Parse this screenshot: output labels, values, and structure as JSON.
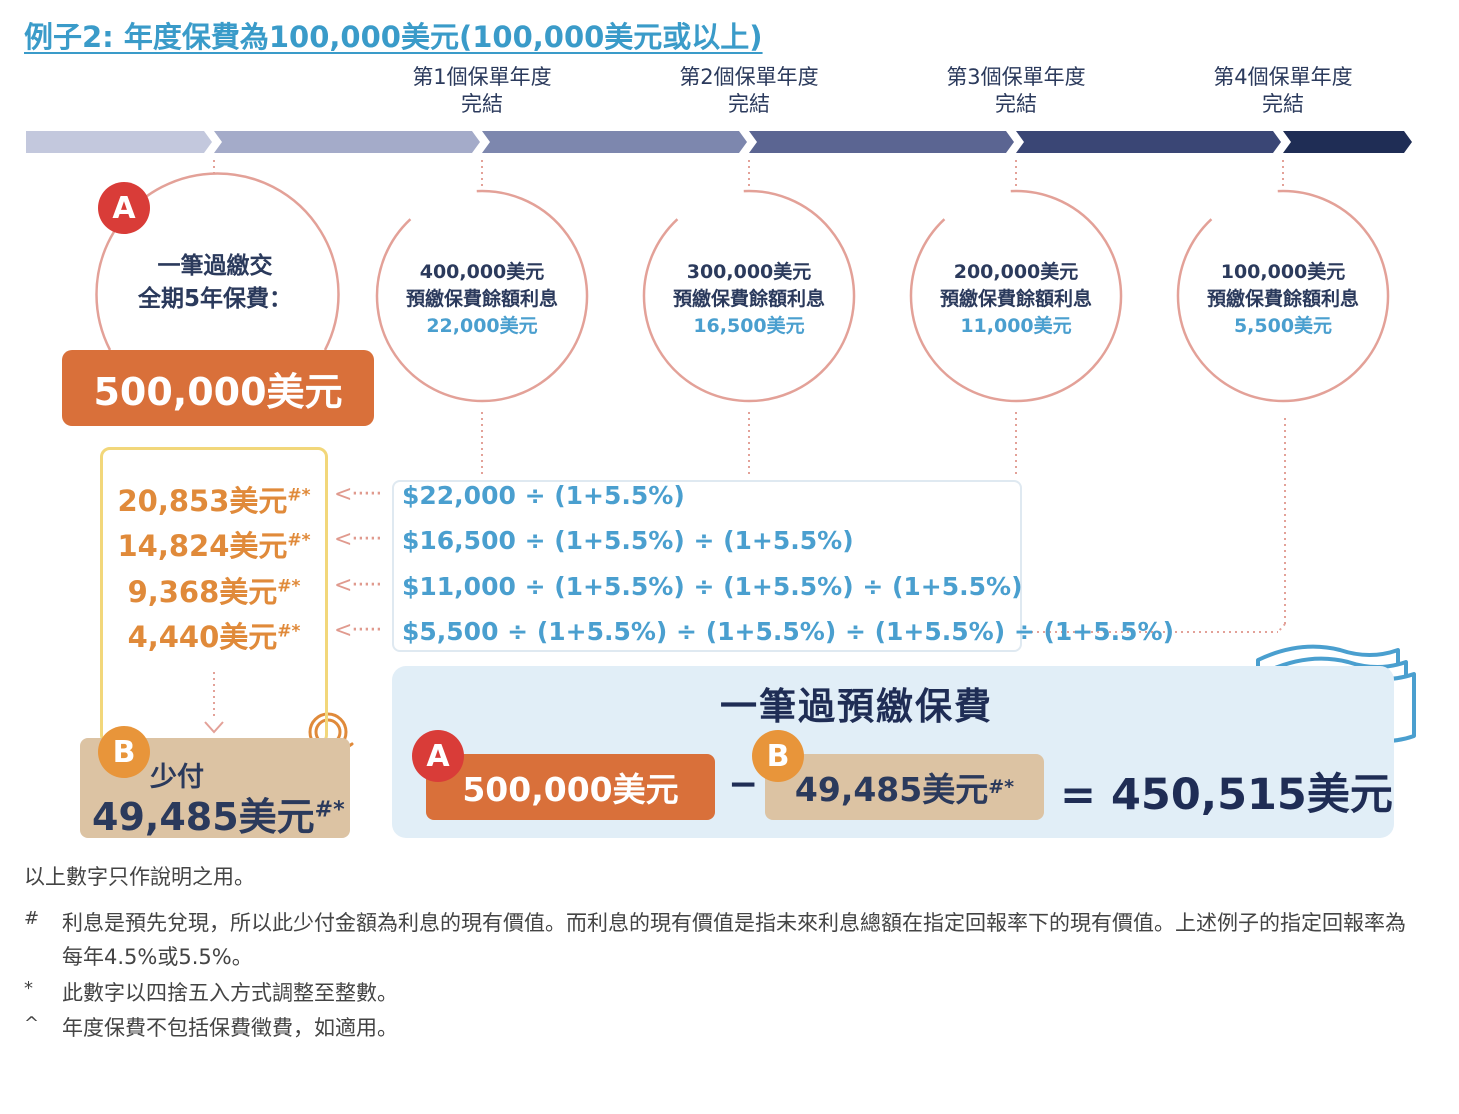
{
  "title": "例子2: 年度保費為100,000美元(100,000美元或以上)",
  "colors": {
    "title": "#3a9bc9",
    "orange": "#d9703a",
    "tan": "#dcc3a3",
    "badge_red": "#d93c38",
    "badge_orange": "#e8953a",
    "navy": "#1f2d55",
    "light_blue": "#4a9fcf",
    "circle_stroke": "#e3a198",
    "panel_bg": "#e1eef7"
  },
  "years": [
    {
      "line1": "第1個保單年度",
      "line2": "完結",
      "principal": "400,000美元",
      "label": "預繳保費餘額利息",
      "interest": "22,000美元"
    },
    {
      "line1": "第2個保單年度",
      "line2": "完結",
      "principal": "300,000美元",
      "label": "預繳保費餘額利息",
      "interest": "16,500美元"
    },
    {
      "line1": "第3個保單年度",
      "line2": "完結",
      "principal": "200,000美元",
      "label": "預繳保費餘額利息",
      "interest": "11,000美元"
    },
    {
      "line1": "第4個保單年度",
      "line2": "完結",
      "principal": "100,000美元",
      "label": "預繳保費餘額利息",
      "interest": "5,500美元"
    }
  ],
  "lump": {
    "badge": "A",
    "line1": "一筆過繳交",
    "line2": "全期5年保費：",
    "amount": "500,000美元"
  },
  "present_values": [
    {
      "value": "20,853美元",
      "mark": "#*"
    },
    {
      "value": "14,824美元",
      "mark": "#*"
    },
    {
      "value": "9,368美元",
      "mark": "#*"
    },
    {
      "value": "4,440美元",
      "mark": "#*"
    }
  ],
  "calcs": [
    "$22,000 ÷ (1+5.5%)",
    "$16,500 ÷ (1+5.5%) ÷ (1+5.5%)",
    "$11,000 ÷ (1+5.5%) ÷ (1+5.5%) ÷ (1+5.5%)",
    "$5,500 ÷ (1+5.5%) ÷ (1+5.5%) ÷ (1+5.5%) ÷ (1+5.5%)"
  ],
  "arrow_glyph": "<·····",
  "saving": {
    "badge": "B",
    "label": "少付",
    "amount": "49,485美元",
    "mark": "#*"
  },
  "equation": {
    "title": "一筆過預繳保費",
    "a_badge": "A",
    "a_amount": "500,000美元",
    "minus": "−",
    "b_badge": "B",
    "b_amount": "49,485美元",
    "b_mark": "#*",
    "result": "= 450,515美元",
    "icon": "dollar-bills-icon"
  },
  "notes": {
    "main": "以上數字只作說明之用。",
    "footnotes": [
      {
        "mark": "#",
        "text": "利息是預先兌現，所以此少付金額為利息的現有價值。而利息的現有價值是指未來利息總額在指定回報率下的現有價值。上述例子的指定回報率為每年4.5%或5.5%。"
      },
      {
        "mark": "*",
        "text": "此數字以四捨五入方式調整至整數。"
      },
      {
        "mark": "^",
        "text": "年度保費不包括保費徵費，如適用。"
      }
    ]
  }
}
